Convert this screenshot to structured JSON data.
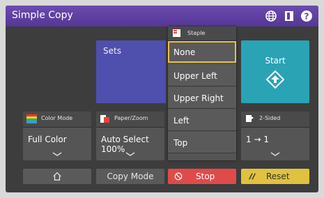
{
  "app": {
    "title": "Simple Copy"
  },
  "header": {
    "icons": [
      "globe-icon",
      "book-icon",
      "help-icon"
    ]
  },
  "sets": {
    "label": "Sets"
  },
  "start": {
    "label": "Start"
  },
  "staple": {
    "label": "Staple",
    "options": [
      "None",
      "Upper Left",
      "Upper Right",
      "Left",
      "Top"
    ],
    "selected": "None"
  },
  "functions": {
    "color_mode": {
      "label": "Color Mode",
      "value": "Full Color"
    },
    "paper_zoom": {
      "label": "Paper/Zoom",
      "value_line1": "Auto Select",
      "value_line2": "100%"
    },
    "two_sided": {
      "label": "2-Sided",
      "value": "1 → 1"
    }
  },
  "bottom": {
    "copy_mode": "Copy Mode",
    "stop": "Stop",
    "reset": "Reset"
  },
  "colors": {
    "title_bar": "#5e3fa0",
    "sets_bg": "#4f4fae",
    "start_bg": "#2aa3b5",
    "stop_bg": "#e04a4a",
    "reset_bg": "#e0c240",
    "selection_border": "#e8c14a"
  }
}
